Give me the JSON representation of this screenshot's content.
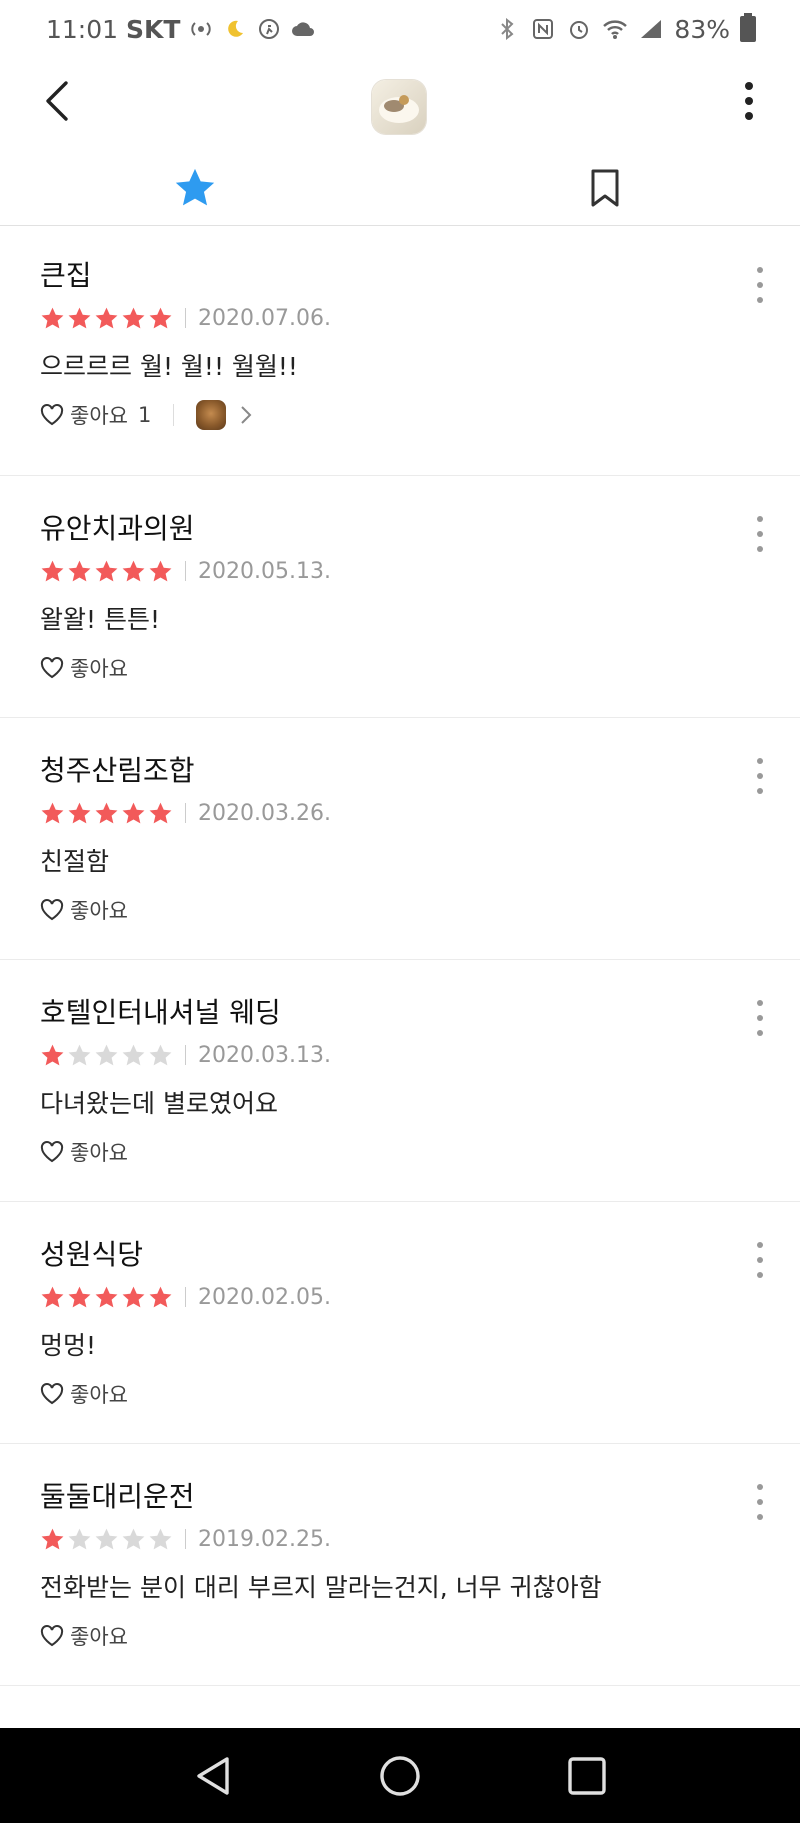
{
  "status_bar": {
    "time": "11:01",
    "carrier": "SKT",
    "battery": "83%"
  },
  "colors": {
    "star_filled": "#f25a5a",
    "star_empty": "#d9d9d9",
    "tab_active": "#2e9bf0"
  },
  "icons": {
    "back": "chevron-left-icon",
    "more": "more-vertical-icon",
    "tab_reviews": "star-icon",
    "tab_saved": "bookmark-icon",
    "like": "heart-outline-icon"
  },
  "reviews": [
    {
      "title": "큰집",
      "rating": 5,
      "date": "2020.07.06.",
      "text": "으르르르 월! 월!! 월월!!",
      "like_label": "좋아요",
      "like_count": "1",
      "has_photo": true
    },
    {
      "title": "유안치과의원",
      "rating": 5,
      "date": "2020.05.13.",
      "text": "왈왈! 튼튼!",
      "like_label": "좋아요",
      "like_count": "",
      "has_photo": false
    },
    {
      "title": "청주산림조합",
      "rating": 5,
      "date": "2020.03.26.",
      "text": "친절함",
      "like_label": "좋아요",
      "like_count": "",
      "has_photo": false
    },
    {
      "title": "호텔인터내셔널 웨딩",
      "rating": 1,
      "date": "2020.03.13.",
      "text": "다녀왔는데 별로였어요",
      "like_label": "좋아요",
      "like_count": "",
      "has_photo": false
    },
    {
      "title": "성원식당",
      "rating": 5,
      "date": "2020.02.05.",
      "text": "멍멍!",
      "like_label": "좋아요",
      "like_count": "",
      "has_photo": false
    },
    {
      "title": "둘둘대리운전",
      "rating": 1,
      "date": "2019.02.25.",
      "text": "전화받는 분이 대리 부르지 말라는건지, 너무 귀찮아함",
      "like_label": "좋아요",
      "like_count": "",
      "has_photo": false
    }
  ]
}
